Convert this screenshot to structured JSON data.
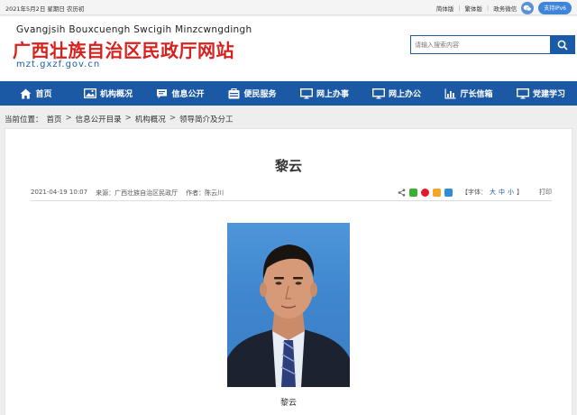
{
  "topbar": {
    "date": "2021年5月2日 星期日 农历初",
    "links": [
      "简体版",
      "繁体版",
      "政务微信"
    ],
    "ipv6": "支持IPv6"
  },
  "header": {
    "pinyin": "Gvangjsih Bouxcuengh Swcigih Minzcwngdingh",
    "title": "广西壮族自治区民政厅网站",
    "url": "mzt.gxzf.gov.cn"
  },
  "search": {
    "placeholder": "请输入搜索内容"
  },
  "nav": [
    {
      "label": "首页",
      "icon": "home-icon"
    },
    {
      "label": "机构概况",
      "icon": "image-icon"
    },
    {
      "label": "信息公开",
      "icon": "chat-icon"
    },
    {
      "label": "便民服务",
      "icon": "service-icon"
    },
    {
      "label": "网上办事",
      "icon": "monitor-icon"
    },
    {
      "label": "网上办公",
      "icon": "monitor-icon"
    },
    {
      "label": "厅长信箱",
      "icon": "chart-icon"
    },
    {
      "label": "党建学习",
      "icon": "monitor-icon"
    }
  ],
  "breadcrumb": {
    "prefix": "当前位置：",
    "items": [
      "首页",
      "信息公开目录",
      "机构概况",
      "领导简介及分工"
    ]
  },
  "article": {
    "title": "黎云",
    "date": "2021-04-19 10:07",
    "source": "来源：广西壮族自治区民政厅",
    "author": "作者：陈云川",
    "font_label": "【字体：",
    "font_sizes": [
      "大",
      "中",
      "小"
    ],
    "font_close": "】",
    "print": "打印",
    "caption": "黎云"
  },
  "colors": {
    "nav": "#1c59a4",
    "logo_red": "#d7211e",
    "url_blue": "#1c5aa8"
  }
}
